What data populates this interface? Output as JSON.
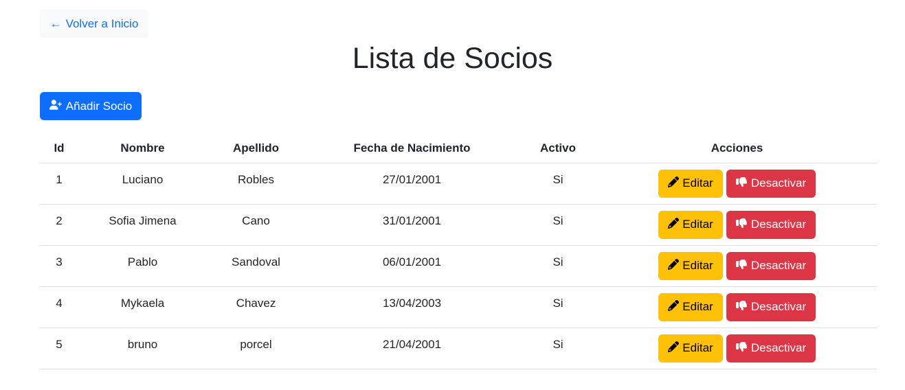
{
  "nav": {
    "back_arrow": "←",
    "back_label": "Volver a Inicio"
  },
  "page": {
    "title": "Lista de Socios"
  },
  "toolbar": {
    "add_label": "Añadir Socio",
    "add_icon": "user-plus-icon"
  },
  "table": {
    "headers": [
      "Id",
      "Nombre",
      "Apellido",
      "Fecha de Nacimiento",
      "Activo",
      "Acciones"
    ],
    "rows": [
      {
        "id": "1",
        "nombre": "Luciano",
        "apellido": "Robles",
        "fecha": "27/01/2001",
        "activo": "Si"
      },
      {
        "id": "2",
        "nombre": "Sofia Jimena",
        "apellido": "Cano",
        "fecha": "31/01/2001",
        "activo": "Si"
      },
      {
        "id": "3",
        "nombre": "Pablo",
        "apellido": "Sandoval",
        "fecha": "06/01/2001",
        "activo": "Si"
      },
      {
        "id": "4",
        "nombre": "Mykaela",
        "apellido": "Chavez",
        "fecha": "13/04/2003",
        "activo": "Si"
      },
      {
        "id": "5",
        "nombre": "bruno",
        "apellido": "porcel",
        "fecha": "21/04/2001",
        "activo": "Si"
      }
    ],
    "edit_label": "Editar",
    "edit_icon": "pencil-icon",
    "deactivate_label": "Desactivar",
    "deactivate_icon": "thumbs-down-icon"
  },
  "colors": {
    "primary": "#0d6efd",
    "warning": "#ffc107",
    "danger": "#dc3545",
    "light": "#f8f9fa"
  }
}
